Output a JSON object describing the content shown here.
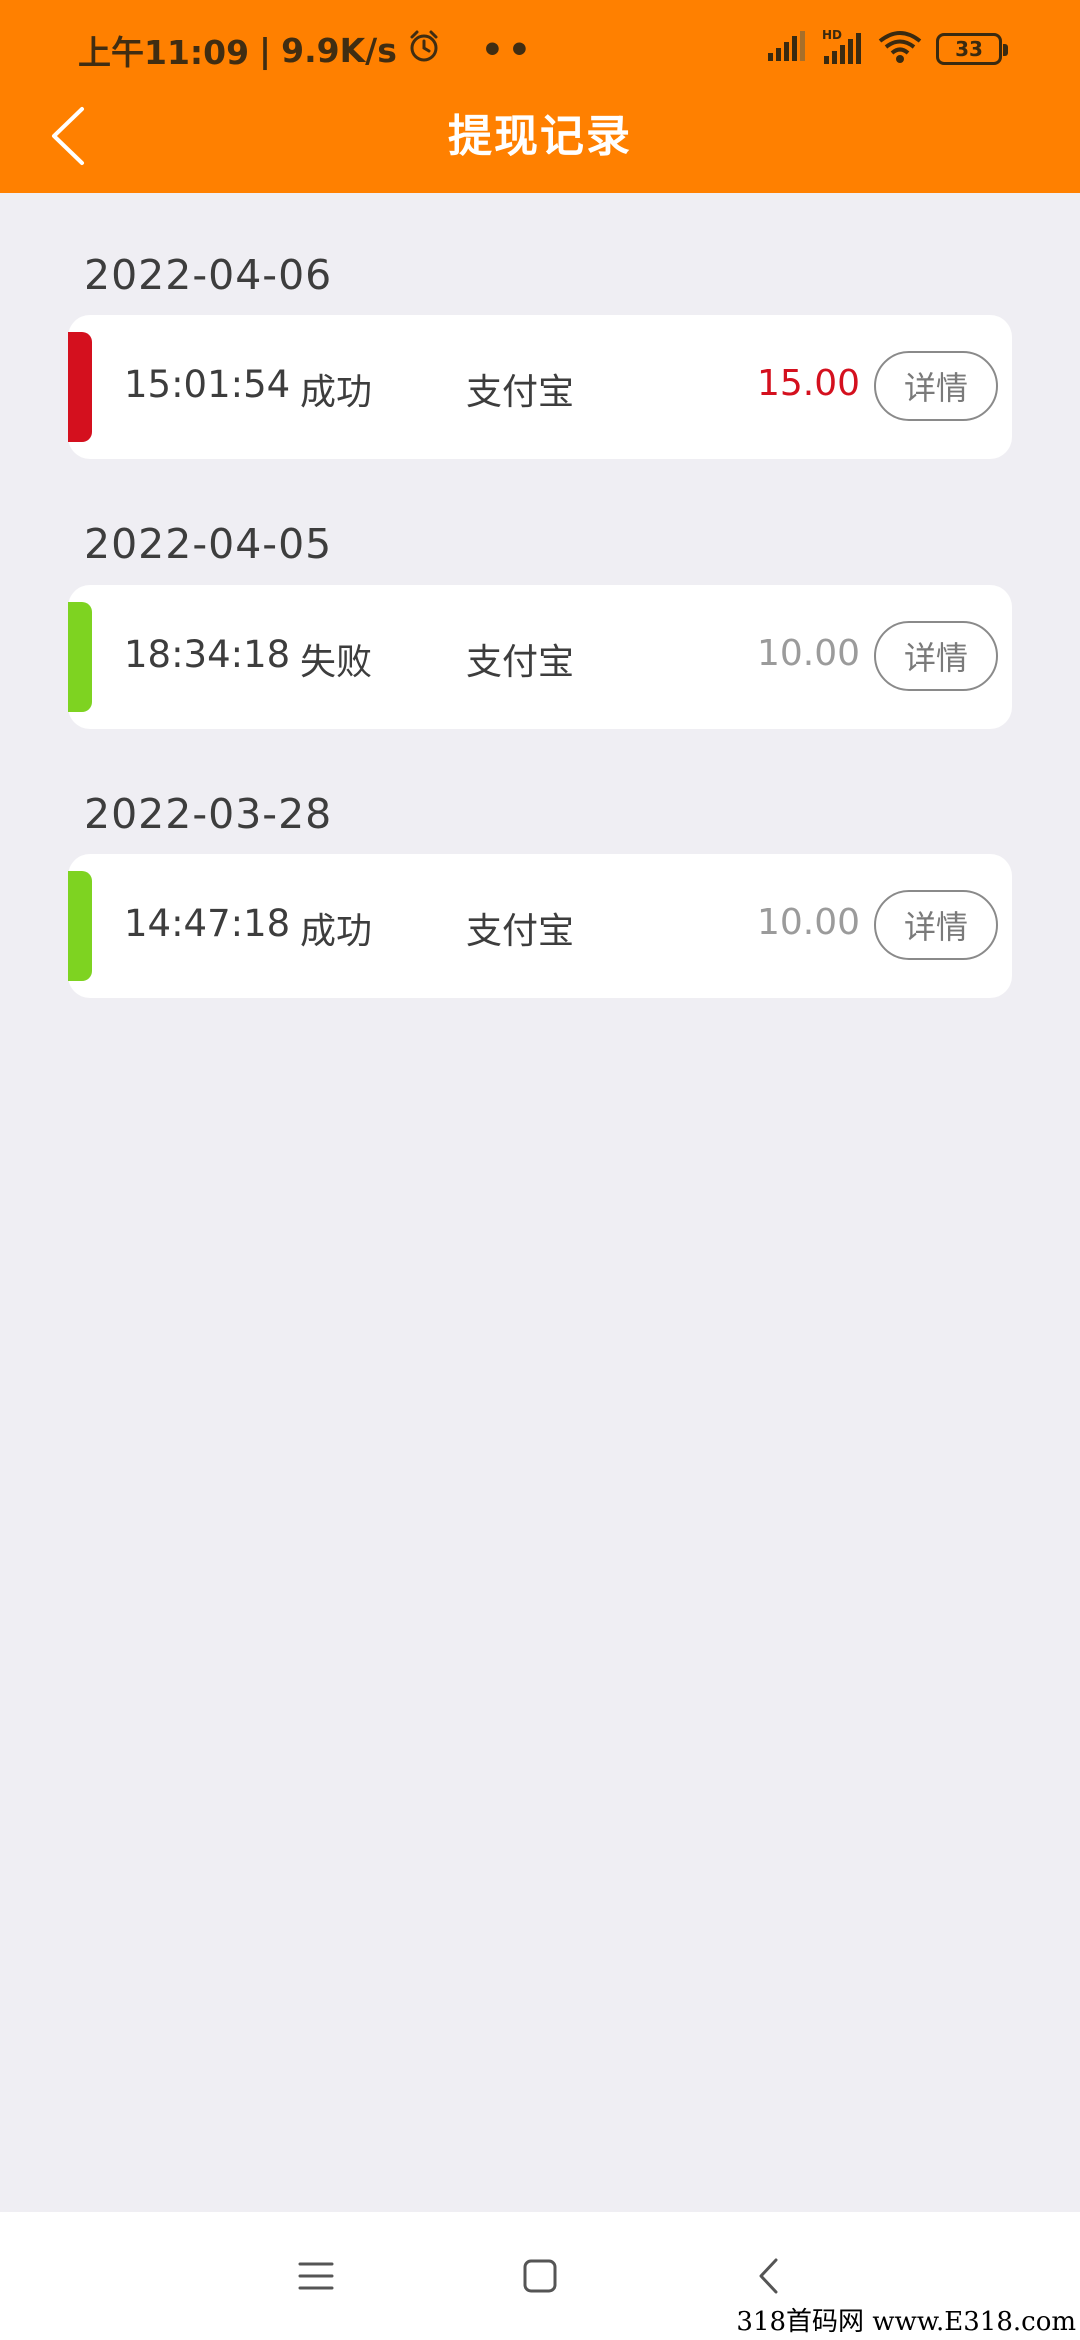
{
  "status_bar": {
    "time": "上午11:09",
    "speed": "9.9K/s",
    "dots": "••",
    "battery": "33",
    "network_badge": "HD",
    "icons": [
      "alarm-icon",
      "signal-icon",
      "hd-signal-icon",
      "wifi-icon",
      "battery-icon"
    ]
  },
  "header": {
    "title": "提现记录",
    "back_icon": "back-arrow-icon",
    "color": "#ff8000"
  },
  "records": [
    {
      "date": "2022-04-06",
      "time": "15:01:54",
      "status": "成功",
      "method": "支付宝",
      "amount": "15.00",
      "detail_label": "详情",
      "bar_color": "#d4101e",
      "amount_color": "#d4101e"
    },
    {
      "date": "2022-04-05",
      "time": "18:34:18",
      "status": "失败",
      "method": "支付宝",
      "amount": "10.00",
      "detail_label": "详情",
      "bar_color": "#7ed321",
      "amount_color": "#9b9b9b"
    },
    {
      "date": "2022-03-28",
      "time": "14:47:18",
      "status": "成功",
      "method": "支付宝",
      "amount": "10.00",
      "detail_label": "详情",
      "bar_color": "#7ed321",
      "amount_color": "#9b9b9b"
    }
  ],
  "nav": {
    "icons": [
      "menu-icon",
      "home-icon",
      "back-icon"
    ]
  },
  "watermark": "318首码网 www.E318.com"
}
